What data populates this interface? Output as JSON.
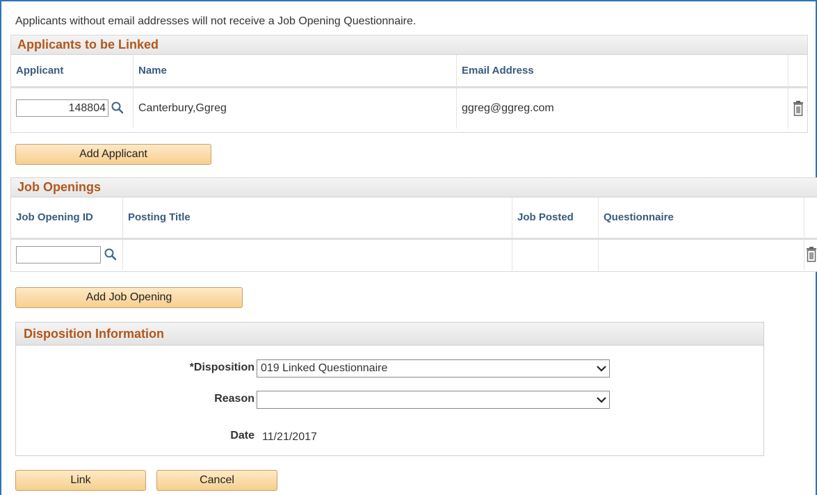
{
  "notice_text": "Applicants without email addresses will not receive a Job Opening Questionnaire.",
  "applicants": {
    "title": "Applicants to be Linked",
    "columns": [
      "Applicant",
      "Name",
      "Email Address"
    ],
    "rows": [
      {
        "applicant_id": "148804",
        "name": "Canterbury,Ggreg",
        "email": "ggreg@ggreg.com"
      }
    ],
    "add_button": "Add Applicant"
  },
  "job_openings": {
    "title": "Job Openings",
    "columns": [
      "Job Opening ID",
      "Posting Title",
      "Job Posted",
      "Questionnaire"
    ],
    "rows": [
      {
        "job_opening_id": "",
        "posting_title": "",
        "job_posted": "",
        "questionnaire": ""
      }
    ],
    "add_button": "Add Job Opening"
  },
  "disposition": {
    "title": "Disposition Information",
    "disposition_label": "*Disposition",
    "disposition_value": "019 Linked Questionnaire",
    "reason_label": "Reason",
    "reason_value": "",
    "date_label": "Date",
    "date_value": "11/21/2017"
  },
  "actions": {
    "link_label": "Link",
    "cancel_label": "Cancel"
  },
  "icons": {
    "lookup": "magnifier-icon",
    "delete": "trash-icon",
    "dropdown": "chevron-down-icon"
  },
  "colors": {
    "section_title": "#b3571b",
    "column_header": "#3a5a80",
    "button_fill": "#f7cf8e",
    "frame": "#2e73b5"
  }
}
